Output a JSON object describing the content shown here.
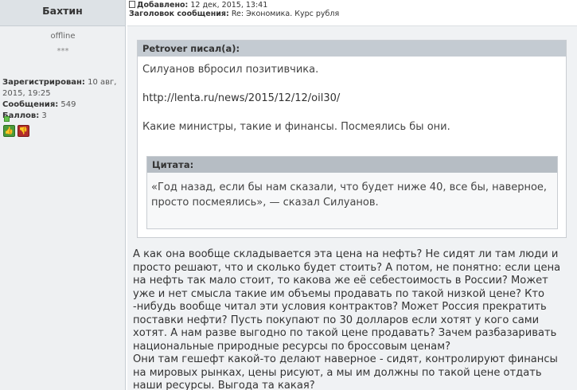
{
  "author": {
    "name": "Бахтин",
    "status": "offline",
    "stars": "***",
    "registered_label": "Зарегистрирован:",
    "registered_value": "10 авг, 2015, 19:25",
    "messages_label": "Сообщения:",
    "messages_value": "549",
    "points_label": "Баллов:",
    "points_value": "3",
    "rate_up": "👍",
    "rate_down": "👎"
  },
  "post": {
    "added_label": "Добавлено:",
    "added_value": "12 дек, 2015, 13:41",
    "subject_label": "Заголовок сообщения:",
    "subject_value": "Re: Экономика. Курс рубля"
  },
  "quote": {
    "author_header": "Petrover писал(а):",
    "line1": "Силуанов вбросил позитивчика.",
    "link": "http://lenta.ru/news/2015/12/12/oil30/",
    "line3": "Какие министры, такие и финансы. Посмеялись бы они.",
    "inner_header": "Цитата:",
    "inner_text": "«Год назад, если бы нам сказали, что будет ниже 40, все бы, наверное, просто посмеялись», — сказал Силуанов."
  },
  "message": {
    "paragraph1": "А как она вообще складывается эта цена на нефть? Не сидят ли там люди и просто решают, что и сколько будет стоить? А потом, не понятно: если цена на нефть так мало стоит, то какова же её себестоимость в России? Может уже и нет смысла такие им объемы продавать по такой низкой цене? Кто -нибудь вообще читал эти условия контрактов? Может Россия прекратить поставки нефти? Пусть покупают по 30 долларов если хотят у кого сами хотят. А нам разве выгодно по такой цене продавать? Зачем разбазаривать национальные природные ресурсы по броссовым ценам?",
    "paragraph2": "Они там гешефт какой-то делают наверное - сидят, контролируют финансы на мировых рынках, цены рисуют, а мы им должны по такой цене отдать наши ресурсы. Выгода та какая?"
  },
  "colors": {
    "header_bg": "#dde2e6",
    "sidebar_bg": "#eef0f2",
    "body_bg": "#f0f2f4",
    "quote_head": "#c4cbd2"
  }
}
